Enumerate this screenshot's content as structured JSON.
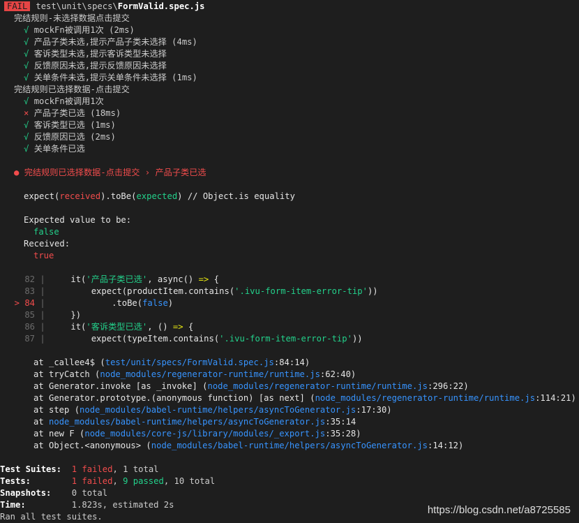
{
  "header": {
    "status": "FAIL",
    "path_prefix": "test\\unit\\specs\\",
    "filename": "FormValid.spec.js"
  },
  "suites": [
    {
      "title": "完结规则-未选择数据点击提交",
      "tests": [
        {
          "mark": "√",
          "name": "mockFn被调用1次 (2ms)"
        },
        {
          "mark": "√",
          "name": "产品子类未选,提示产品子类未选择 (4ms)"
        },
        {
          "mark": "√",
          "name": "客诉类型未选,提示客诉类型未选择"
        },
        {
          "mark": "√",
          "name": "反馈原因未选,提示反馈原因未选择"
        },
        {
          "mark": "√",
          "name": "关单条件未选,提示关单条件未选择 (1ms)"
        }
      ]
    },
    {
      "title": "完结规则已选择数据-点击提交",
      "tests": [
        {
          "mark": "√",
          "name": "mockFn被调用1次"
        },
        {
          "mark": "×",
          "name": "产品子类已选 (18ms)"
        },
        {
          "mark": "√",
          "name": "客诉类型已选 (1ms)"
        },
        {
          "mark": "√",
          "name": "反馈原因已选 (2ms)"
        },
        {
          "mark": "√",
          "name": "关单条件已选"
        }
      ]
    }
  ],
  "failure": {
    "bullet": "●",
    "title": "完结规则已选择数据-点击提交 › 产品子类已选",
    "expect_prefix": "expect(",
    "expect_received": "received",
    "expect_mid": ").toBe(",
    "expect_expected": "expected",
    "expect_suffix": ") // Object.is equality",
    "expected_label": "Expected value to be:",
    "expected_value": "false",
    "received_label": "Received:",
    "received_value": "true"
  },
  "code": [
    {
      "num": "82",
      "active": false,
      "parts": [
        [
          "w",
          "it("
        ],
        [
          "s",
          "'产品子类已选'"
        ],
        [
          "w",
          ", async() "
        ],
        [
          "y",
          "=>"
        ],
        [
          "w",
          " {"
        ]
      ],
      "indent": 4
    },
    {
      "num": "83",
      "active": false,
      "parts": [
        [
          "w",
          "expect(productItem.contains("
        ],
        [
          "s",
          "'.ivu-form-item-error-tip'"
        ],
        [
          "w",
          "))"
        ]
      ],
      "indent": 8
    },
    {
      "num": "84",
      "active": true,
      "parts": [
        [
          "w",
          ".toBe("
        ],
        [
          "k",
          "false"
        ],
        [
          "w",
          ")"
        ]
      ],
      "indent": 12
    },
    {
      "num": "85",
      "active": false,
      "parts": [
        [
          "w",
          "})"
        ]
      ],
      "indent": 4
    },
    {
      "num": "86",
      "active": false,
      "parts": [
        [
          "w",
          "it("
        ],
        [
          "s",
          "'客诉类型已选'"
        ],
        [
          "w",
          ", () "
        ],
        [
          "y",
          "=>"
        ],
        [
          "w",
          " {"
        ]
      ],
      "indent": 4
    },
    {
      "num": "87",
      "active": false,
      "parts": [
        [
          "w",
          "expect(typeItem.contains("
        ],
        [
          "s",
          "'.ivu-form-item-error-tip'"
        ],
        [
          "w",
          "))"
        ]
      ],
      "indent": 8
    }
  ],
  "code_marker": ">",
  "code_sep": "|",
  "stack": [
    {
      "pre": "at _callee4$ (",
      "link": "test/unit/specs/FormValid.spec.js",
      "pos": ":84:14",
      "post": ")"
    },
    {
      "pre": "at tryCatch (",
      "link": "node_modules/regenerator-runtime/runtime.js",
      "pos": ":62:40",
      "post": ")"
    },
    {
      "pre": "at Generator.invoke [as _invoke] (",
      "link": "node_modules/regenerator-runtime/runtime.js",
      "pos": ":296:22",
      "post": ")"
    },
    {
      "pre": "at Generator.prototype.(anonymous function) [as next] (",
      "link": "node_modules/regenerator-runtime/runtime.js",
      "pos": ":114:21",
      "post": ")"
    },
    {
      "pre": "at step (",
      "link": "node_modules/babel-runtime/helpers/asyncToGenerator.js",
      "pos": ":17:30",
      "post": ")"
    },
    {
      "pre": "at ",
      "link": "node_modules/babel-runtime/helpers/asyncToGenerator.js",
      "pos": ":35:14",
      "post": ""
    },
    {
      "pre": "at new F (",
      "link": "node_modules/core-js/library/modules/_export.js",
      "pos": ":35:28",
      "post": ")"
    },
    {
      "pre": "at Object.<anonymous> (",
      "link": "node_modules/babel-runtime/helpers/asyncToGenerator.js",
      "pos": ":14:12",
      "post": ")"
    }
  ],
  "summary": {
    "suites_label": "Test Suites:",
    "suites_failed": "1 failed",
    "suites_total": ", 1 total",
    "tests_label": "Tests:",
    "tests_failed": "1 failed",
    "tests_sep": ", ",
    "tests_passed": "9 passed",
    "tests_total": ", 10 total",
    "snapshots_label": "Snapshots:",
    "snapshots_value": "0 total",
    "time_label": "Time:",
    "time_value": "1.823s, estimated 2s",
    "ran_all": "Ran all test suites."
  },
  "watermark": "https://blog.csdn.net/a8725585",
  "colors": {
    "background": "#1e1e1e",
    "pass": "#23d18b",
    "fail": "#f14c4c",
    "link": "#3794ff"
  }
}
